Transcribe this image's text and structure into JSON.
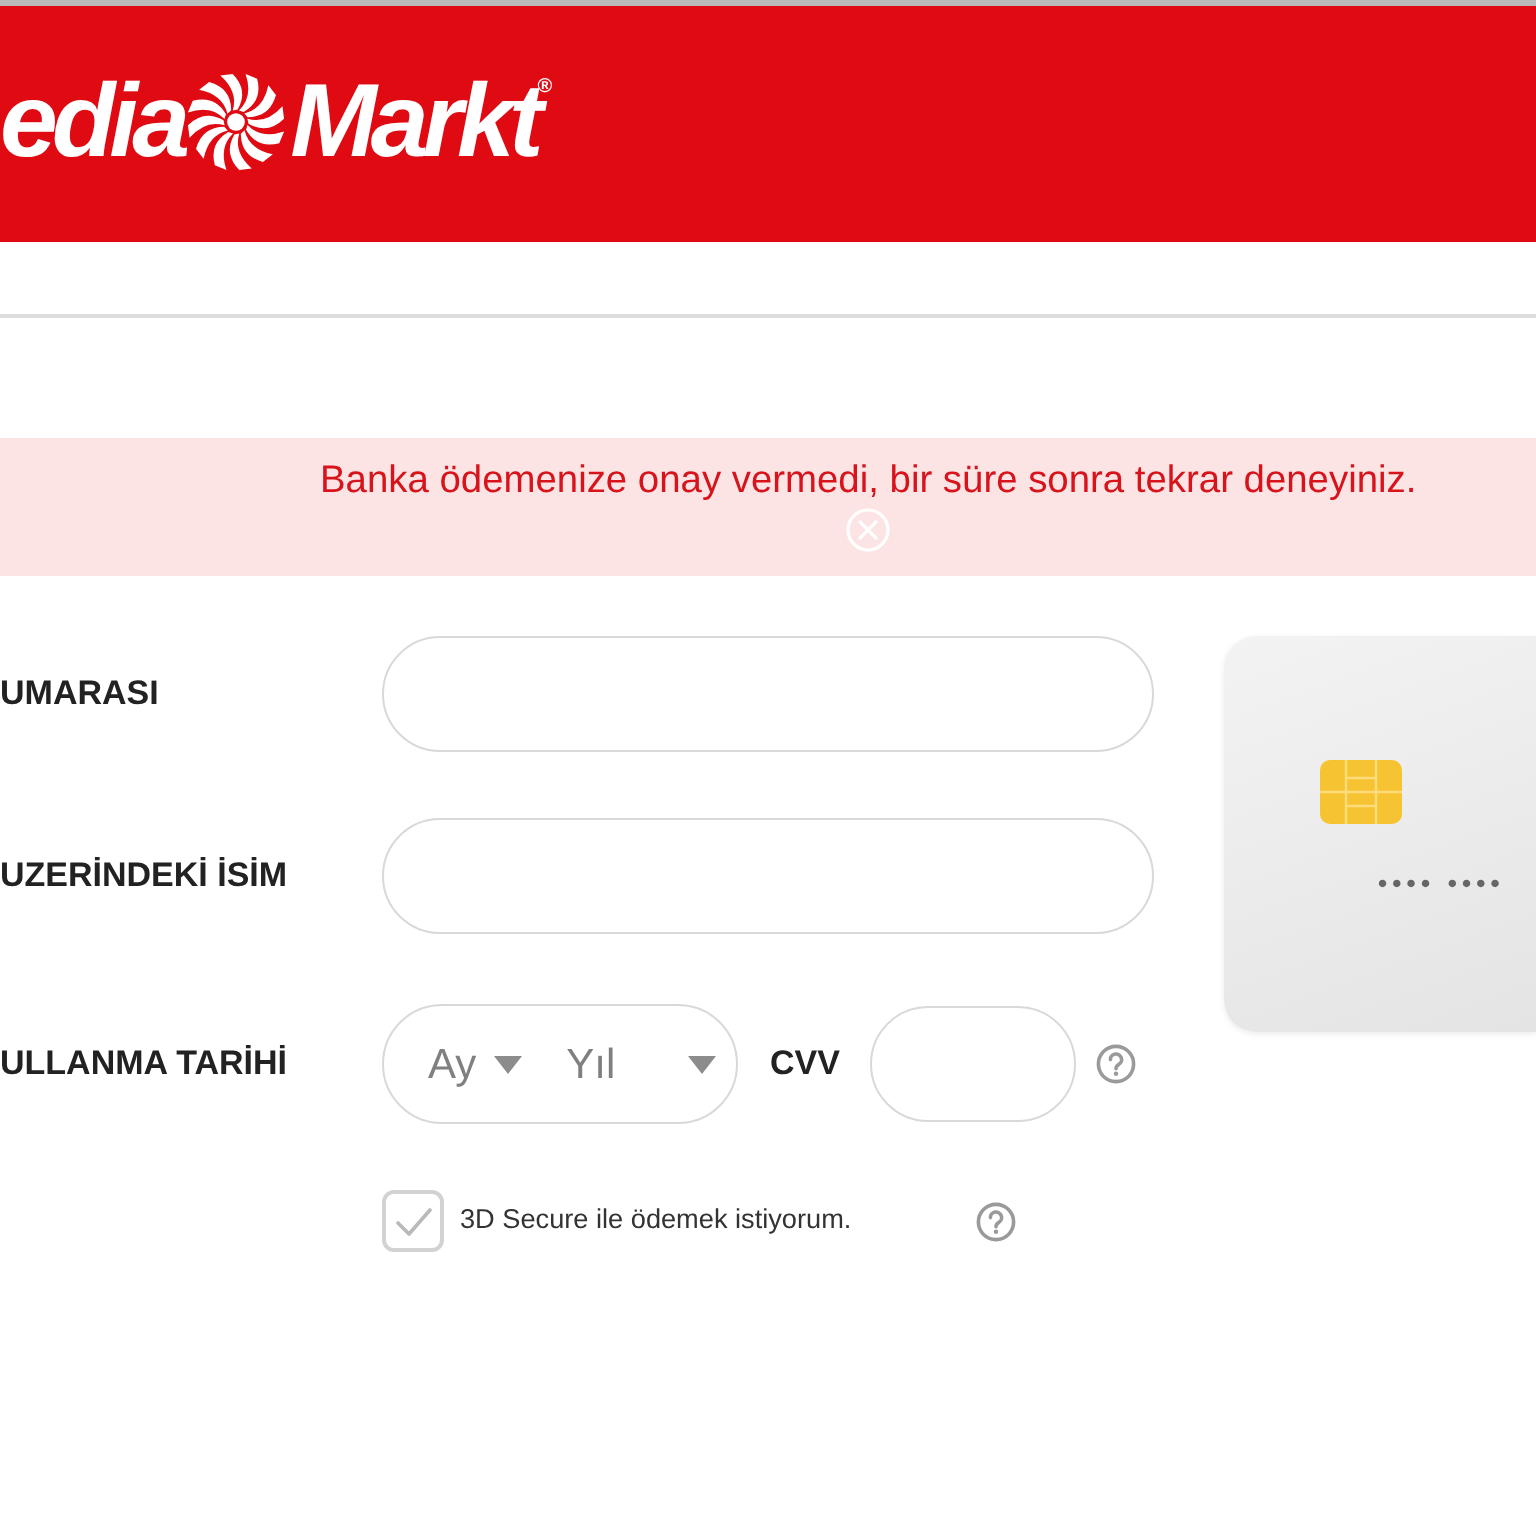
{
  "header": {
    "logo": {
      "left": "edia",
      "right": "Markt",
      "mark": "®"
    }
  },
  "alert": {
    "message": "Banka ödemenize onay vermedi, bir süre sonra tekrar deneyiniz."
  },
  "form": {
    "fields": [
      {
        "kind": "text",
        "label": "UMARASI"
      },
      {
        "kind": "text",
        "label": "UZERİNDEKİ İSİM"
      },
      {
        "kind": "expiry",
        "label": "ULLANMA TARİHİ",
        "month": "Ay",
        "year": "Yıl",
        "cvv_label": "CVV"
      }
    ],
    "secure_option": {
      "label": "3D Secure ile ödemek istiyorum.",
      "checked": true
    }
  },
  "card_preview": {
    "number": "•••• ••••"
  }
}
